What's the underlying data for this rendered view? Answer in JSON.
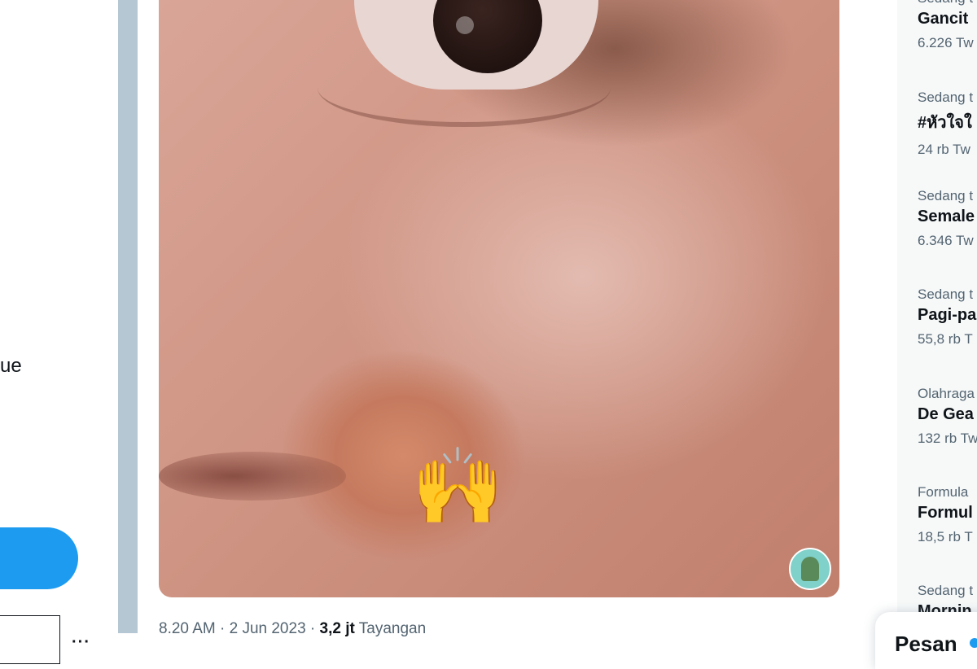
{
  "left_nav": {
    "partial_text": "ue",
    "more_icon": "ellipsis-icon"
  },
  "tweet": {
    "time": "8.20 AM",
    "separator1": " · ",
    "date": "2 Jun 2023",
    "separator2": " · ",
    "views": "3,2 jt",
    "views_label": " Tayangan",
    "media_emoji": "🙌"
  },
  "trends": [
    {
      "context": "Sedang t",
      "name": "Gancit",
      "count": "6.226 Tw"
    },
    {
      "context": "Sedang t",
      "name": "#หัวใจใ",
      "count": "24 rb Tw"
    },
    {
      "context": "Sedang t",
      "name": "Semale",
      "count": "6.346 Tw"
    },
    {
      "context": "Sedang t",
      "name": "Pagi-pa",
      "count": "55,8 rb T"
    },
    {
      "context": "Olahraga",
      "name": "De Gea",
      "count": "132 rb Tw"
    },
    {
      "context": "Formula",
      "name": "Formul",
      "count": "18,5 rb T"
    },
    {
      "context": "Sedang t",
      "name": "Mornin",
      "count": ""
    }
  ],
  "messages": {
    "label": "Pesan"
  },
  "colors": {
    "accent": "#1d9bf0",
    "gutter": "#b5c7d3",
    "muted_text": "#536471"
  }
}
